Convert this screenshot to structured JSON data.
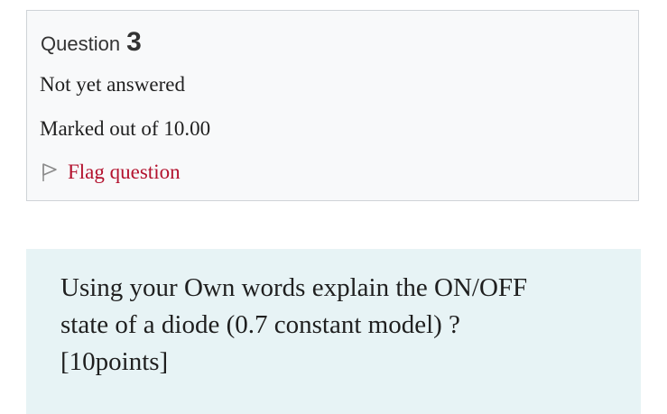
{
  "question_info": {
    "label": "Question",
    "number": "3",
    "state": "Not yet answered",
    "grade": "Marked out of 10.00",
    "flag": {
      "icon": "flag-outline-icon",
      "label": "Flag question",
      "color": "#b3122e"
    }
  },
  "question": {
    "text_line1": "Using your Own words explain the ON/OFF",
    "text_line2": "state of a diode (0.7 constant model) ?",
    "text_line3": "[10points]"
  },
  "colors": {
    "info_background": "#f8f9fa",
    "info_border": "#cfd3d7",
    "question_background": "#e7f3f5"
  }
}
